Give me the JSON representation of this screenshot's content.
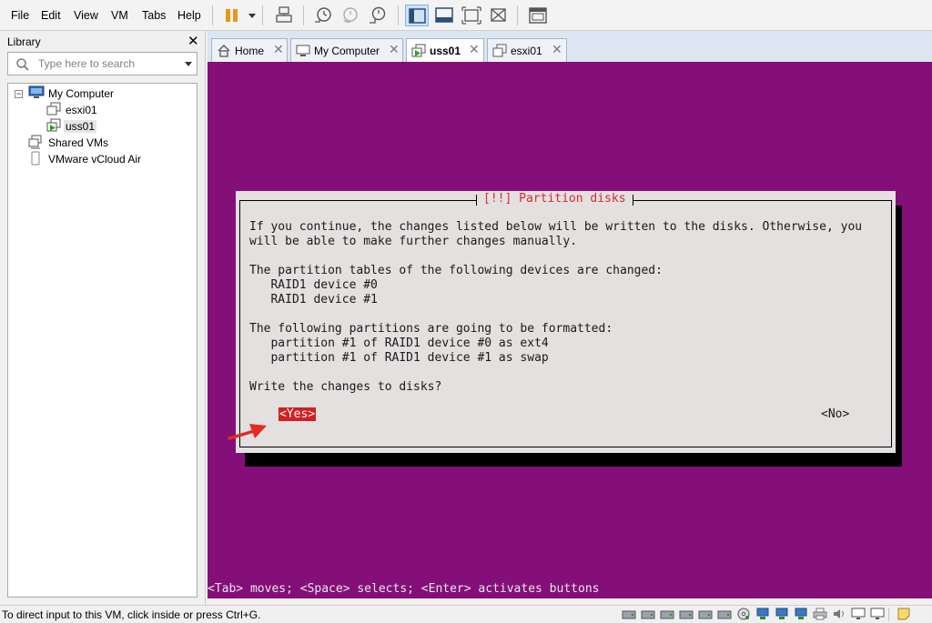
{
  "menubar": {
    "items": [
      "File",
      "Edit",
      "View",
      "VM",
      "Tabs",
      "Help"
    ],
    "tools": [
      "pause-icon",
      "dropdown-arrow-icon",
      "send-keys-icon",
      "snapshot-icon",
      "revert-snapshot-icon",
      "snapshot-manager-icon",
      "show-library-icon",
      "thumbnail-bar-icon",
      "full-screen-icon",
      "unity-icon",
      "console-view-icon"
    ]
  },
  "library": {
    "title": "Library",
    "close_glyph": "✕",
    "search": {
      "placeholder": "Type here to search",
      "value": ""
    },
    "tree": [
      {
        "label": "My Computer",
        "icon": "computer-icon",
        "expander": "−"
      },
      {
        "label": "esxi01",
        "icon": "vm-icon"
      },
      {
        "label": "uss01",
        "icon": "vm-running-icon",
        "selected": true
      },
      {
        "label": "Shared VMs",
        "icon": "shared-vms-icon"
      },
      {
        "label": "VMware vCloud Air",
        "icon": "cloud-icon"
      }
    ]
  },
  "tabs": [
    {
      "label": "Home",
      "icon": "home-icon"
    },
    {
      "label": "My Computer",
      "icon": "computer-icon"
    },
    {
      "label": "uss01",
      "icon": "vm-running-icon",
      "active": true
    },
    {
      "label": "esxi01",
      "icon": "vm-icon"
    }
  ],
  "tab_close_glyph": "✕",
  "console": {
    "bg_color": "#850f78",
    "dialog": {
      "title": "[!!] Partition disks",
      "lines": [
        "If you continue, the changes listed below will be written to the disks. Otherwise, you",
        "will be able to make further changes manually.",
        "The partition tables of the following devices are changed:",
        "   RAID1 device #0",
        "   RAID1 device #1",
        "The following partitions are going to be formatted:",
        "   partition #1 of RAID1 device #0 as ext4",
        "   partition #1 of RAID1 device #1 as swap",
        "Write the changes to disks?"
      ],
      "yes_button": "<Yes>",
      "no_button": "<No>"
    },
    "hint": "<Tab> moves; <Space> selects; <Enter> activates buttons"
  },
  "statusbar": {
    "text": "To direct input to this VM, click inside or press Ctrl+G.",
    "devices": [
      "hard-disk-icon",
      "hard-disk-icon",
      "hard-disk-icon",
      "hard-disk-icon",
      "hard-disk-icon",
      "hard-disk-icon",
      "hard-disk-icon",
      "cd-drive-icon",
      "network-icon",
      "network-icon",
      "network-icon",
      "printer-icon",
      "sound-icon",
      "display-icon",
      "message-log-icon"
    ]
  }
}
